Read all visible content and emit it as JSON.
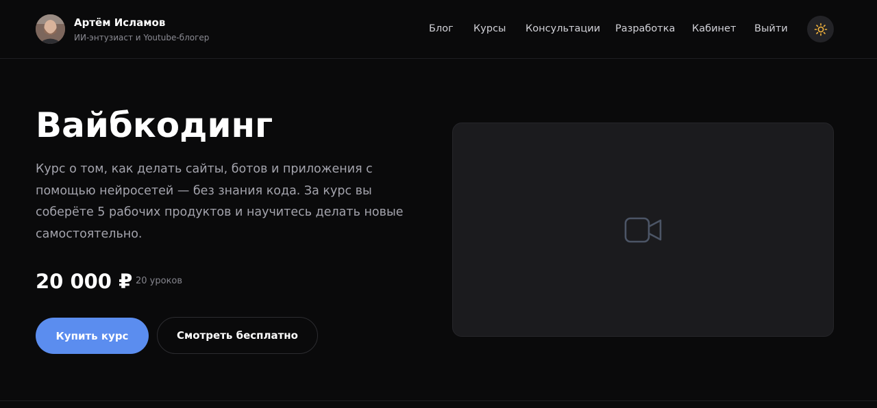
{
  "header": {
    "name": "Артём Исламов",
    "subtitle": "ИИ-энтузиаст и Youtube-блогер",
    "nav": [
      {
        "label": "Блог"
      },
      {
        "label": "Курсы"
      },
      {
        "label": "Консультации"
      },
      {
        "label": "Разработка"
      },
      {
        "label": "Кабинет"
      },
      {
        "label": "Выйти"
      }
    ],
    "theme_icon": "sun-icon"
  },
  "course": {
    "title": "Вайбкодинг",
    "description": "Курс о том, как делать сайты, ботов и приложения с помощью нейросетей — без знания кода. За курс вы соберёте 5 рабочих продуктов и научитесь делать новые самостоятельно.",
    "price": "20 000 ₽",
    "lessons": "20 уроков",
    "buy_label": "Купить курс",
    "watch_label": "Смотреть бесплатно",
    "video_icon": "video-camera-icon"
  },
  "colors": {
    "background": "#0a0a0b",
    "accent": "#5b8def",
    "sun": "#f3b33d"
  }
}
